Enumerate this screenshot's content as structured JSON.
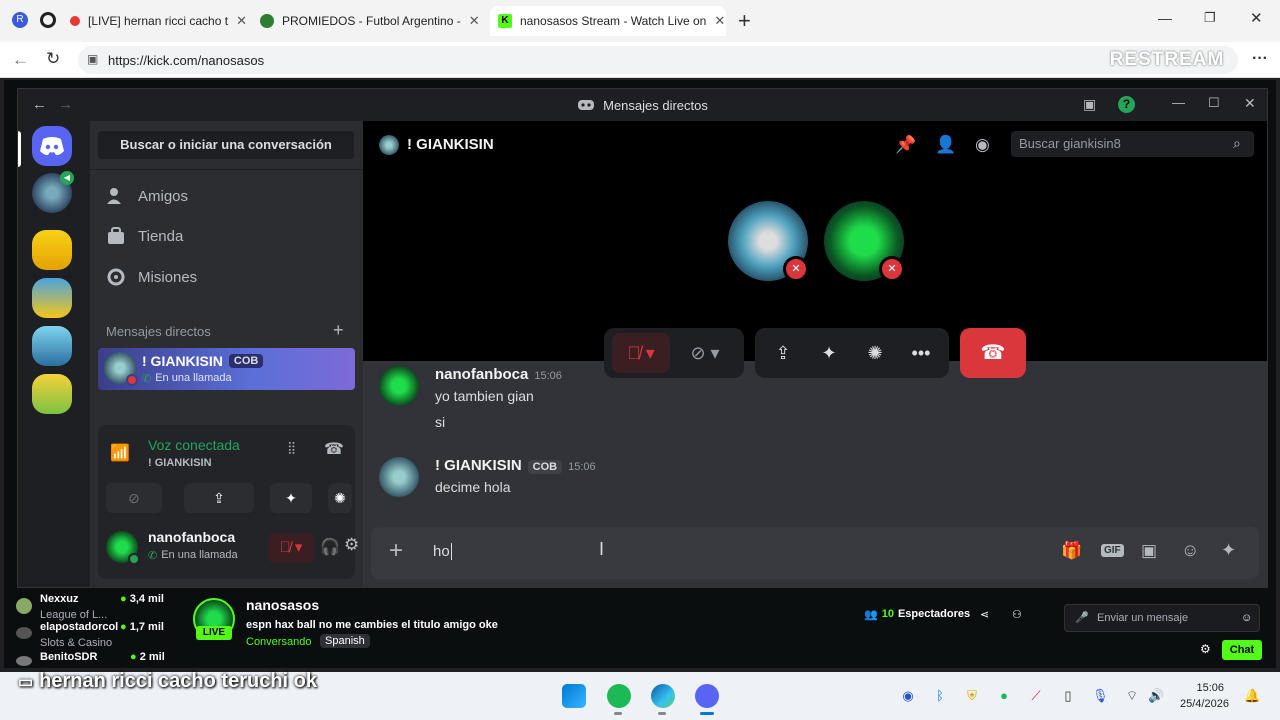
{
  "browser": {
    "tabs": [
      {
        "label": "[LIVE] hernan ricci cacho t",
        "favicon_color": "#e53935"
      },
      {
        "label": "PROMIEDOS - Futbol Argentino - ",
        "favicon_color": "#2e7d32"
      },
      {
        "label": "nanosasos Stream - Watch Live on",
        "favicon_color": "#000000"
      }
    ],
    "url": "https://kick.com/nanosasos",
    "overlay_logo": "RESTREAM"
  },
  "discord": {
    "window_title": "Mensajes directos",
    "sidebar": {
      "search_button": "Buscar o iniciar una conversación",
      "nav": [
        {
          "label": "Amigos",
          "icon": "friends-icon"
        },
        {
          "label": "Tienda",
          "icon": "shop-icon"
        },
        {
          "label": "Misiones",
          "icon": "quests-icon"
        }
      ],
      "dm_header": "Mensajes directos",
      "dm_item": {
        "name": "! GIANKISIN",
        "tag": "COB",
        "status": "En una llamada"
      },
      "voice": {
        "title": "Voz conectada",
        "channel": "! GIANKISIN"
      },
      "user": {
        "name": "nanofanboca",
        "status": "En una llamada"
      }
    },
    "chat": {
      "header_name": "! GIANKISIN",
      "search_placeholder": "Buscar giankisin8",
      "messages": [
        {
          "author": "nanofanboca",
          "time": "15:06",
          "lines": [
            "yo tambien gian",
            "si"
          ]
        },
        {
          "author": "! GIANKISIN",
          "tag": "COB",
          "time": "15:06",
          "lines": [
            "decime hola"
          ]
        }
      ],
      "input_value": "ho"
    }
  },
  "kick": {
    "recommended": [
      {
        "name": "Nexxuz",
        "category": "League of L...",
        "viewers": "3,4 mil"
      },
      {
        "name": "elapostadorcol",
        "category": "Slots & Casino",
        "viewers": "1,7 mil"
      },
      {
        "name": "BenitoSDR",
        "category": "",
        "viewers": "2 mil"
      }
    ],
    "streamer": "nanosasos",
    "live_badge": "LIVE",
    "stream_title": "espn hax ball no me cambies el titulo amigo oke",
    "category": "Conversando",
    "language": "Spanish",
    "viewers_count": "10",
    "viewers_label": "Espectadores",
    "chat_placeholder": "Enviar un mensaje",
    "chat_button": "Chat"
  },
  "overlay_caption": "hernan ricci cacho teruchi ok",
  "taskbar": {
    "time": "15:06",
    "date": "25/4/2026"
  },
  "colors": {
    "discord_blurple": "#5865f2",
    "kick_green": "#53fc18",
    "hangup_red": "#da373c"
  }
}
